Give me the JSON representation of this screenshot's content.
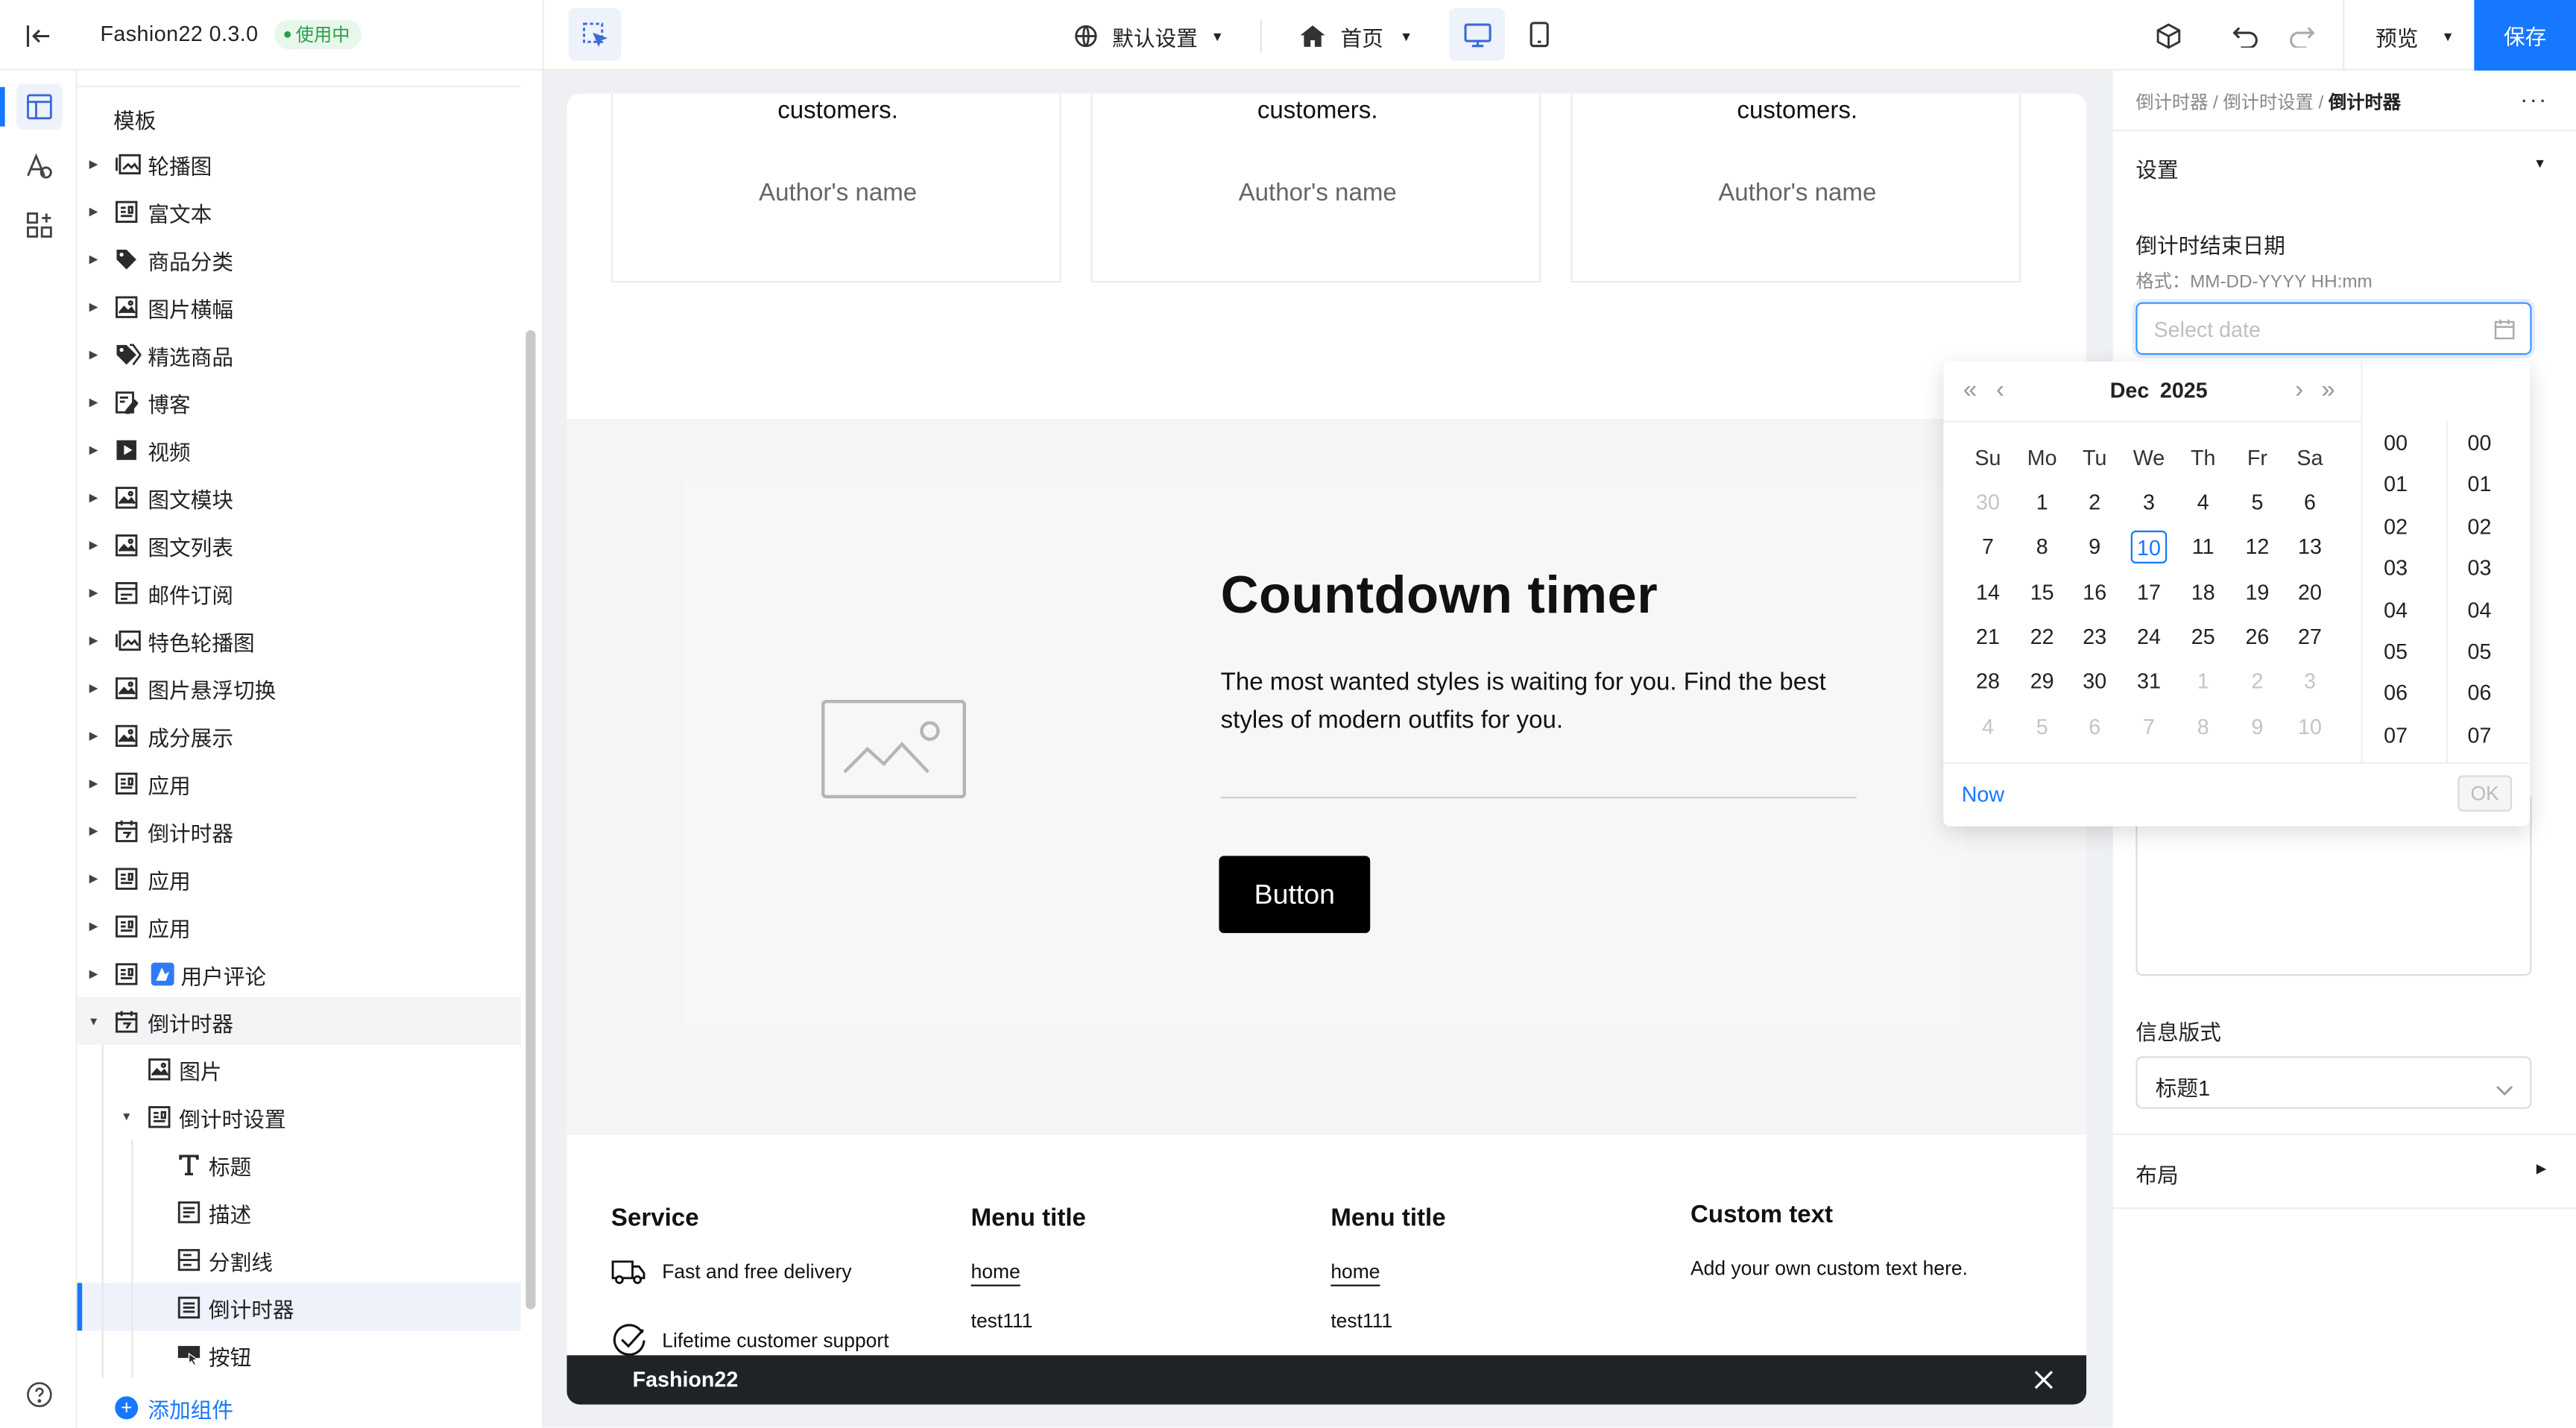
{
  "header": {
    "app_name": "Fashion22 0.3.0",
    "status_badge": "使用中",
    "locale_label": "默认设置",
    "page_label": "首页",
    "preview_label": "预览",
    "save_label": "保存"
  },
  "tree": {
    "section_title": "模板",
    "items": [
      {
        "label": "轮播图",
        "icon": "carousel-icon"
      },
      {
        "label": "富文本",
        "icon": "richtext-icon"
      },
      {
        "label": "商品分类",
        "icon": "tag-icon"
      },
      {
        "label": "图片横幅",
        "icon": "image-icon"
      },
      {
        "label": "精选商品",
        "icon": "tags-icon"
      },
      {
        "label": "博客",
        "icon": "blog-icon"
      },
      {
        "label": "视频",
        "icon": "video-icon"
      },
      {
        "label": "图文模块",
        "icon": "image-text-icon"
      },
      {
        "label": "图文列表",
        "icon": "image-list-icon"
      },
      {
        "label": "邮件订阅",
        "icon": "mail-icon"
      },
      {
        "label": "特色轮播图",
        "icon": "carousel-icon"
      },
      {
        "label": "图片悬浮切换",
        "icon": "image-icon"
      },
      {
        "label": "成分展示",
        "icon": "image-icon"
      },
      {
        "label": "应用",
        "icon": "app-icon"
      },
      {
        "label": "倒计时器",
        "icon": "calendar-icon"
      },
      {
        "label": "应用",
        "icon": "app-icon"
      },
      {
        "label": "应用",
        "icon": "app-icon"
      },
      {
        "label": "用户评论",
        "icon": "app-icon"
      },
      {
        "label": "倒计时器",
        "icon": "calendar-icon"
      }
    ],
    "children": [
      {
        "label": "图片",
        "icon": "image-icon"
      },
      {
        "label": "倒计时设置",
        "icon": "app-icon"
      },
      {
        "label": "标题",
        "icon": "text-icon"
      },
      {
        "label": "描述",
        "icon": "description-icon"
      },
      {
        "label": "分割线",
        "icon": "divider-icon"
      },
      {
        "label": "倒计时器",
        "icon": "countdown-icon"
      },
      {
        "label": "按钮",
        "icon": "button-icon"
      }
    ],
    "add_component": "添加组件"
  },
  "canvas": {
    "testimonials": [
      {
        "quote_tail": "customers.",
        "author": "Author's name"
      },
      {
        "quote_tail": "customers.",
        "author": "Author's name"
      },
      {
        "quote_tail": "customers.",
        "author": "Author's name"
      }
    ],
    "countdown": {
      "title": "Countdown timer",
      "description": "The most wanted styles is waiting for you. Find the best styles of modern outfits for you.",
      "button": "Button"
    },
    "footer": {
      "service_title": "Service",
      "service_items": [
        "Fast and free delivery",
        "Lifetime customer support"
      ],
      "menu1_title": "Menu title",
      "menu1_items": [
        "home",
        "test111"
      ],
      "menu2_title": "Menu title",
      "menu2_items": [
        "home",
        "test111"
      ],
      "custom_title": "Custom text",
      "custom_text": "Add your own custom text here."
    },
    "bottom_bar": "Fashion22"
  },
  "right_panel": {
    "breadcrumb": [
      "倒计时器",
      "倒计时设置",
      "倒计时器"
    ],
    "settings_title": "设置",
    "end_date_label": "倒计时结束日期",
    "format_hint": "格式：MM-DD-YYYY HH:mm",
    "date_placeholder": "Select date",
    "info_style_label": "信息版式",
    "info_style_value": "标题1",
    "layout_label": "布局"
  },
  "calendar": {
    "month": "Dec",
    "year": "2025",
    "weekdays": [
      "Su",
      "Mo",
      "Tu",
      "We",
      "Th",
      "Fr",
      "Sa"
    ],
    "days": [
      [
        "30",
        "1",
        "2",
        "3",
        "4",
        "5",
        "6"
      ],
      [
        "7",
        "8",
        "9",
        "10",
        "11",
        "12",
        "13"
      ],
      [
        "14",
        "15",
        "16",
        "17",
        "18",
        "19",
        "20"
      ],
      [
        "21",
        "22",
        "23",
        "24",
        "25",
        "26",
        "27"
      ],
      [
        "28",
        "29",
        "30",
        "31",
        "1",
        "2",
        "3"
      ],
      [
        "4",
        "5",
        "6",
        "7",
        "8",
        "9",
        "10"
      ]
    ],
    "today": "10",
    "hours": [
      "00",
      "01",
      "02",
      "03",
      "04",
      "05",
      "06",
      "07"
    ],
    "minutes": [
      "00",
      "01",
      "02",
      "03",
      "04",
      "05",
      "06",
      "07"
    ],
    "now_label": "Now",
    "ok_label": "OK"
  },
  "colors": {
    "accent": "#1677ff",
    "badge_bg": "#e8f7ec",
    "badge_text": "#2a9d4b",
    "selected_row": "#eef2fb"
  }
}
